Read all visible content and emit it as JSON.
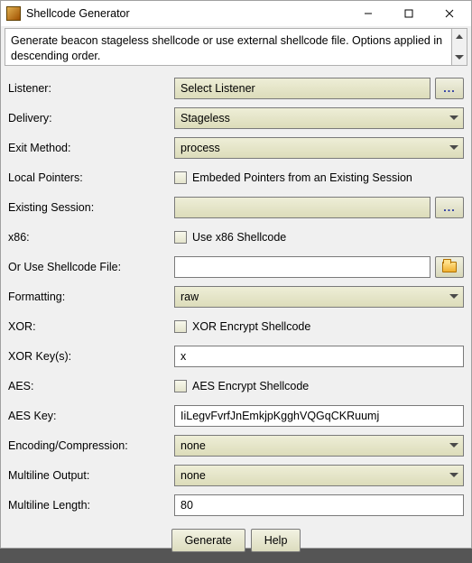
{
  "window": {
    "title": "Shellcode Generator"
  },
  "description": "Generate beacon stageless shellcode or use external shellcode file. Options applied in descending order.",
  "labels": {
    "listener": "Listener:",
    "delivery": "Delivery:",
    "exit_method": "Exit Method:",
    "local_pointers": "Local Pointers:",
    "existing_session": "Existing Session:",
    "x86": "x86:",
    "shellcode_file": "Or Use Shellcode File:",
    "formatting": "Formatting:",
    "xor": "XOR:",
    "xor_keys": "XOR Key(s):",
    "aes": "AES:",
    "aes_key": "AES Key:",
    "encoding": "Encoding/Compression:",
    "multiline_output": "Multiline Output:",
    "multiline_length": "Multiline Length:"
  },
  "values": {
    "listener": "Select Listener",
    "delivery": "Stageless",
    "exit_method": "process",
    "local_pointers_label": "Embeded Pointers from an Existing Session",
    "existing_session": "",
    "x86_label": "Use x86 Shellcode",
    "shellcode_file": "",
    "formatting": "raw",
    "xor_label": "XOR Encrypt Shellcode",
    "xor_keys": "x",
    "aes_label": "AES Encrypt Shellcode",
    "aes_key": "IiLegvFvrfJnEmkjpKgghVQGqCKRuumj",
    "encoding": "none",
    "multiline_output": "none",
    "multiline_length": "80"
  },
  "buttons": {
    "ellipsis": "...",
    "generate": "Generate",
    "help": "Help"
  }
}
